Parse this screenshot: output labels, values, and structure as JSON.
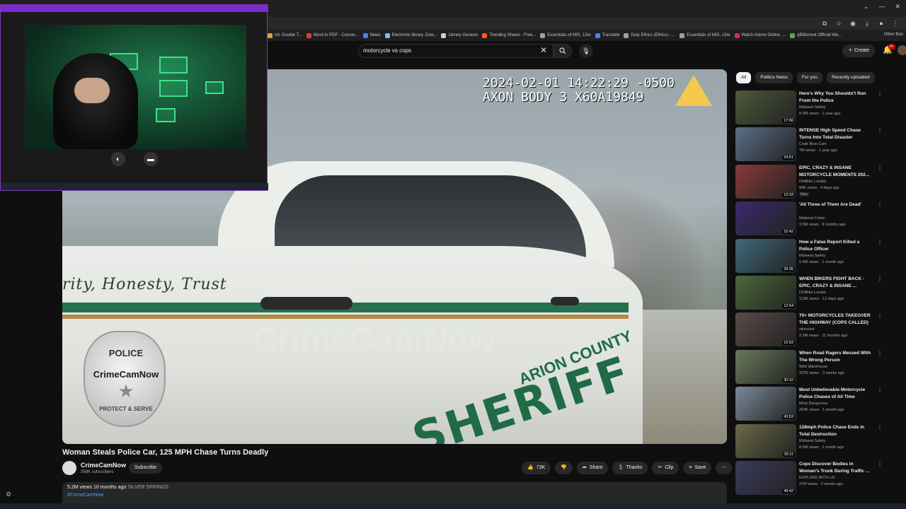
{
  "browser": {
    "bookmarks": [
      {
        "label": "nd: Double T...",
        "color": "#e6a23c"
      },
      {
        "label": "Word to PDF - Conver...",
        "color": "#e53935"
      },
      {
        "label": "News",
        "color": "#4285f4"
      },
      {
        "label": "Electronic library. Dow...",
        "color": "#8ab4f8"
      },
      {
        "label": "Library Genesis",
        "color": "#cccccc"
      },
      {
        "label": "Trending Shows - Free...",
        "color": "#ff5722"
      },
      {
        "label": "Essentials of MIS, 13/e",
        "color": "#9e9e9e"
      },
      {
        "label": "Translate",
        "color": "#4285f4"
      },
      {
        "label": "Duty Ethics (Ethics) - ...",
        "color": "#9e9e9e"
      },
      {
        "label": "Essentials of MIS, 13/e",
        "color": "#9e9e9e"
      },
      {
        "label": "Watch Anime Online, ...",
        "color": "#e91e63"
      },
      {
        "label": "qBittorrent Official We...",
        "color": "#4caf50"
      }
    ],
    "other_bookmarks": "Other Boo"
  },
  "header": {
    "search_value": "motorcycle vs cops",
    "create_label": "Create",
    "notif_count": "9+"
  },
  "video": {
    "timestamp_line1": "2024-02-01 14:22:29 -0500",
    "timestamp_line2": "AXON BODY 3 X60A19849",
    "car_script": "rity, Honesty, Trust",
    "car_sheriff": "SHERIFF",
    "car_county": "ARION COUNTY",
    "watermark": "CrimeCamNow",
    "badge_top": "POLICE",
    "badge_name": "CrimeCamNow",
    "badge_motto": "PROTECT & SERVE",
    "title": "Woman Steals Police Car, 125 MPH Chase Turns Deadly"
  },
  "channel": {
    "name": "CrimeCamNow",
    "subs": "358K subscribers",
    "subscribe_label": "Subscribe"
  },
  "actions": {
    "likes": "73K",
    "share": "Share",
    "thanks": "Thanks",
    "clip": "Clip",
    "save": "Save"
  },
  "description": {
    "views": "5.2M views",
    "age": "10 months ago",
    "location": "SILVER SPRINGS",
    "hashtag": "#CrimeCamNow"
  },
  "sidebar": {
    "chips": [
      "All",
      "Politics News",
      "For you",
      "Recently uploaded"
    ],
    "recs": [
      {
        "title": "Here's Why You Shouldn't Run From the Police",
        "channel": "Midwest Safety",
        "meta": "8.9M views · 1 year ago",
        "duration": "17:06",
        "thumb": "#4d5a3a",
        "badge": ""
      },
      {
        "title": "INTENSE High Speed Chase Turns Into Total Disaster",
        "channel": "Code Blue Cam",
        "meta": "7M views · 1 year ago",
        "duration": "24:51",
        "thumb": "#5b6f88",
        "badge": ""
      },
      {
        "title": "EPIC, CRAZY & INSANE MOTORCYCLE MOMENTS 202...",
        "channel": "DirtBike Lunatic",
        "meta": "84K views · 4 days ago",
        "duration": "13:33",
        "thumb": "#8a3a3a",
        "badge": "New"
      },
      {
        "title": "'All Three of Them Are Dead'",
        "channel": "Midwest Crime",
        "meta": "3.5M views · 9 months ago",
        "duration": "10:42",
        "thumb": "#3a2a6a",
        "badge": ""
      },
      {
        "title": "How a False Report Killed a Police Officer",
        "channel": "Midwest Safety",
        "meta": "6.4M views · 1 month ago",
        "duration": "39:35",
        "thumb": "#3f6a7a",
        "badge": ""
      },
      {
        "title": "WHEN BIKERS FIGHT BACK - EPIC, CRAZY & INSANE ...",
        "channel": "DirtBike Lunatic",
        "meta": "123K views · 12 days ago",
        "duration": "12:54",
        "thumb": "#4a6a3a",
        "badge": ""
      },
      {
        "title": "70+ MOTORCYCLES TAKEOVER THE HIGHWAY (COPS CALLED)",
        "channel": "sikrocket",
        "meta": "2.2M views · 11 months ago",
        "duration": "16:52",
        "thumb": "#5a4a4a",
        "badge": ""
      },
      {
        "title": "When Road Ragers Messed With The Wrong Person",
        "channel": "Wild Warehouse",
        "meta": "337K views · 3 weeks ago",
        "duration": "30:10",
        "thumb": "#6a7a5a",
        "badge": ""
      },
      {
        "title": "Most Unbelievable Motorcycle Police Chases of All Time",
        "channel": "Most Dangerous",
        "meta": "254K views · 1 month ago",
        "duration": "43:53",
        "thumb": "#7a8a9a",
        "badge": ""
      },
      {
        "title": "128mph Police Chase Ends in Total Destruction",
        "channel": "Midwest Safety",
        "meta": "8.5M views · 1 month ago",
        "duration": "35:11",
        "thumb": "#6a6a4a",
        "badge": ""
      },
      {
        "title": "Cops Discover Bodies in Woman's Trunk During Traffic ...",
        "channel": "EXPLORE WITH US",
        "meta": "27M views · 2 weeks ago",
        "duration": "49:42",
        "thumb": "#3a3a5a",
        "badge": ""
      }
    ]
  }
}
